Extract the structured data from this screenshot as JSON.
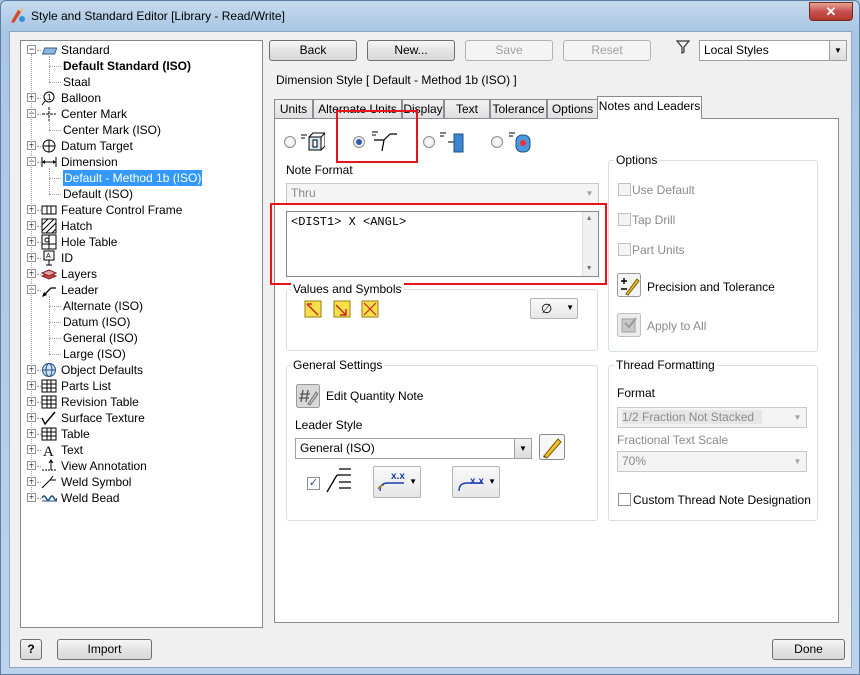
{
  "window": {
    "title": "Style and Standard Editor [Library - Read/Write]",
    "close_label": "✕"
  },
  "tree": {
    "items": [
      {
        "label": "Standard",
        "top": 0
      },
      {
        "label": "Default Standard (ISO)"
      },
      {
        "label": "Staal"
      },
      {
        "label": "Balloon"
      },
      {
        "label": "Center Mark"
      },
      {
        "label": "Center Mark (ISO)"
      },
      {
        "label": "Datum Target"
      },
      {
        "label": "Dimension"
      },
      {
        "label": "Default - Method 1b (ISO)"
      },
      {
        "label": "Default (ISO)"
      },
      {
        "label": "Feature Control Frame"
      },
      {
        "label": "Hatch"
      },
      {
        "label": "Hole Table"
      },
      {
        "label": "ID"
      },
      {
        "label": "Layers"
      },
      {
        "label": "Leader"
      },
      {
        "label": "Alternate (ISO)"
      },
      {
        "label": "Datum (ISO)"
      },
      {
        "label": "General (ISO)"
      },
      {
        "label": "Large (ISO)"
      },
      {
        "label": "Object Defaults"
      },
      {
        "label": "Parts List"
      },
      {
        "label": "Revision Table"
      },
      {
        "label": "Surface Texture"
      },
      {
        "label": "Table"
      },
      {
        "label": "Text"
      },
      {
        "label": "View Annotation"
      },
      {
        "label": "Weld Symbol"
      },
      {
        "label": "Weld Bead"
      }
    ]
  },
  "toolbar": {
    "back": "Back",
    "new": "New...",
    "save": "Save",
    "reset": "Reset",
    "filter_value": "Local Styles"
  },
  "style_heading": "Dimension Style [ Default - Method 1b (ISO) ]",
  "tabs": [
    "Units",
    "Alternate Units",
    "Display",
    "Text",
    "Tolerance",
    "Options",
    "Notes and Leaders"
  ],
  "note_format": {
    "label": "Note Format",
    "type_value": "Thru",
    "text": "<DIST1> X <ANGL>",
    "values_symbols_label": "Values and Symbols",
    "symbol_value": "∅"
  },
  "options": {
    "title": "Options",
    "use_default": "Use Default",
    "tap_drill": "Tap Drill",
    "part_units": "Part Units",
    "precision": "Precision and Tolerance",
    "apply_all": "Apply to All"
  },
  "general": {
    "title": "General Settings",
    "edit_quantity": "Edit Quantity Note",
    "leader_style_label": "Leader Style",
    "leader_style_value": "General (ISO)",
    "xx1": "x.x",
    "xx2": "x.x"
  },
  "thread": {
    "title": "Thread Formatting",
    "format_label": "Format",
    "format_value": "1/2 Fraction Not Stacked",
    "scale_label": "Fractional Text Scale",
    "scale_value": "70%",
    "custom": "Custom Thread Note Designation"
  },
  "footer": {
    "help": "?",
    "import": "Import",
    "done": "Done"
  },
  "colors": {
    "accent": "#3399ff",
    "highlight_box": "#e8141a"
  }
}
